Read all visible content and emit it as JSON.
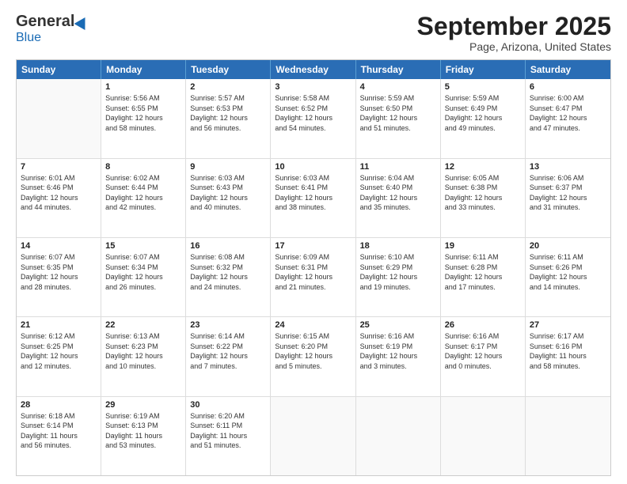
{
  "logo": {
    "general": "General",
    "blue": "Blue"
  },
  "title": "September 2025",
  "location": "Page, Arizona, United States",
  "header_days": [
    "Sunday",
    "Monday",
    "Tuesday",
    "Wednesday",
    "Thursday",
    "Friday",
    "Saturday"
  ],
  "rows": [
    [
      {
        "day": "",
        "info": ""
      },
      {
        "day": "1",
        "info": "Sunrise: 5:56 AM\nSunset: 6:55 PM\nDaylight: 12 hours\nand 58 minutes."
      },
      {
        "day": "2",
        "info": "Sunrise: 5:57 AM\nSunset: 6:53 PM\nDaylight: 12 hours\nand 56 minutes."
      },
      {
        "day": "3",
        "info": "Sunrise: 5:58 AM\nSunset: 6:52 PM\nDaylight: 12 hours\nand 54 minutes."
      },
      {
        "day": "4",
        "info": "Sunrise: 5:59 AM\nSunset: 6:50 PM\nDaylight: 12 hours\nand 51 minutes."
      },
      {
        "day": "5",
        "info": "Sunrise: 5:59 AM\nSunset: 6:49 PM\nDaylight: 12 hours\nand 49 minutes."
      },
      {
        "day": "6",
        "info": "Sunrise: 6:00 AM\nSunset: 6:47 PM\nDaylight: 12 hours\nand 47 minutes."
      }
    ],
    [
      {
        "day": "7",
        "info": "Sunrise: 6:01 AM\nSunset: 6:46 PM\nDaylight: 12 hours\nand 44 minutes."
      },
      {
        "day": "8",
        "info": "Sunrise: 6:02 AM\nSunset: 6:44 PM\nDaylight: 12 hours\nand 42 minutes."
      },
      {
        "day": "9",
        "info": "Sunrise: 6:03 AM\nSunset: 6:43 PM\nDaylight: 12 hours\nand 40 minutes."
      },
      {
        "day": "10",
        "info": "Sunrise: 6:03 AM\nSunset: 6:41 PM\nDaylight: 12 hours\nand 38 minutes."
      },
      {
        "day": "11",
        "info": "Sunrise: 6:04 AM\nSunset: 6:40 PM\nDaylight: 12 hours\nand 35 minutes."
      },
      {
        "day": "12",
        "info": "Sunrise: 6:05 AM\nSunset: 6:38 PM\nDaylight: 12 hours\nand 33 minutes."
      },
      {
        "day": "13",
        "info": "Sunrise: 6:06 AM\nSunset: 6:37 PM\nDaylight: 12 hours\nand 31 minutes."
      }
    ],
    [
      {
        "day": "14",
        "info": "Sunrise: 6:07 AM\nSunset: 6:35 PM\nDaylight: 12 hours\nand 28 minutes."
      },
      {
        "day": "15",
        "info": "Sunrise: 6:07 AM\nSunset: 6:34 PM\nDaylight: 12 hours\nand 26 minutes."
      },
      {
        "day": "16",
        "info": "Sunrise: 6:08 AM\nSunset: 6:32 PM\nDaylight: 12 hours\nand 24 minutes."
      },
      {
        "day": "17",
        "info": "Sunrise: 6:09 AM\nSunset: 6:31 PM\nDaylight: 12 hours\nand 21 minutes."
      },
      {
        "day": "18",
        "info": "Sunrise: 6:10 AM\nSunset: 6:29 PM\nDaylight: 12 hours\nand 19 minutes."
      },
      {
        "day": "19",
        "info": "Sunrise: 6:11 AM\nSunset: 6:28 PM\nDaylight: 12 hours\nand 17 minutes."
      },
      {
        "day": "20",
        "info": "Sunrise: 6:11 AM\nSunset: 6:26 PM\nDaylight: 12 hours\nand 14 minutes."
      }
    ],
    [
      {
        "day": "21",
        "info": "Sunrise: 6:12 AM\nSunset: 6:25 PM\nDaylight: 12 hours\nand 12 minutes."
      },
      {
        "day": "22",
        "info": "Sunrise: 6:13 AM\nSunset: 6:23 PM\nDaylight: 12 hours\nand 10 minutes."
      },
      {
        "day": "23",
        "info": "Sunrise: 6:14 AM\nSunset: 6:22 PM\nDaylight: 12 hours\nand 7 minutes."
      },
      {
        "day": "24",
        "info": "Sunrise: 6:15 AM\nSunset: 6:20 PM\nDaylight: 12 hours\nand 5 minutes."
      },
      {
        "day": "25",
        "info": "Sunrise: 6:16 AM\nSunset: 6:19 PM\nDaylight: 12 hours\nand 3 minutes."
      },
      {
        "day": "26",
        "info": "Sunrise: 6:16 AM\nSunset: 6:17 PM\nDaylight: 12 hours\nand 0 minutes."
      },
      {
        "day": "27",
        "info": "Sunrise: 6:17 AM\nSunset: 6:16 PM\nDaylight: 11 hours\nand 58 minutes."
      }
    ],
    [
      {
        "day": "28",
        "info": "Sunrise: 6:18 AM\nSunset: 6:14 PM\nDaylight: 11 hours\nand 56 minutes."
      },
      {
        "day": "29",
        "info": "Sunrise: 6:19 AM\nSunset: 6:13 PM\nDaylight: 11 hours\nand 53 minutes."
      },
      {
        "day": "30",
        "info": "Sunrise: 6:20 AM\nSunset: 6:11 PM\nDaylight: 11 hours\nand 51 minutes."
      },
      {
        "day": "",
        "info": ""
      },
      {
        "day": "",
        "info": ""
      },
      {
        "day": "",
        "info": ""
      },
      {
        "day": "",
        "info": ""
      }
    ]
  ]
}
